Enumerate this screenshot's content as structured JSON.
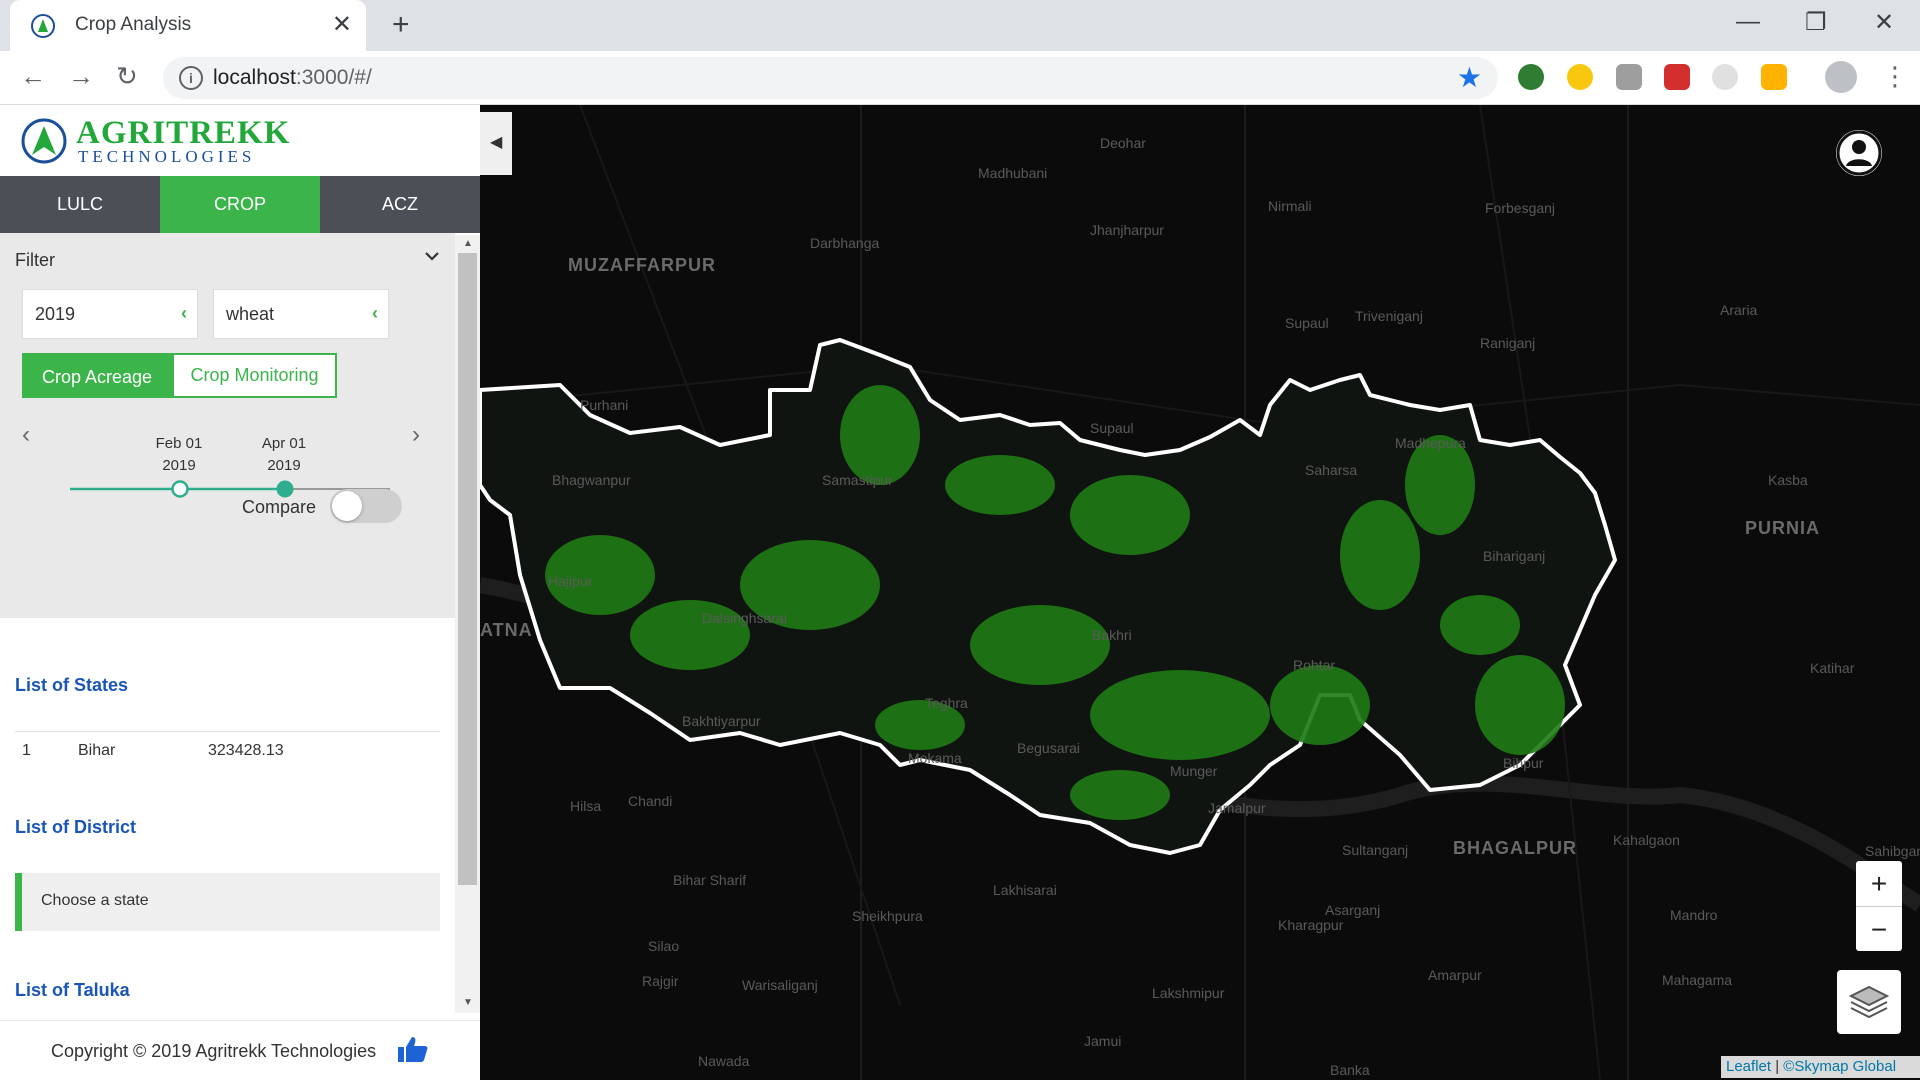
{
  "browser": {
    "tab_title": "Crop Analysis",
    "url_host": "localhost",
    "url_rest": ":3000/#/"
  },
  "app": {
    "brand_line1": "AGRITREKK",
    "brand_line2": "TECHNOLOGIES",
    "tabs": [
      {
        "label": "LULC",
        "active": false
      },
      {
        "label": "CROP",
        "active": true
      },
      {
        "label": "ACZ",
        "active": false
      }
    ],
    "filter": {
      "title": "Filter",
      "year": "2019",
      "crop": "wheat",
      "btn_acreage": "Crop Acreage",
      "btn_monitoring": "Crop Monitoring",
      "timeline": [
        {
          "date": "Feb 01",
          "year": "2019"
        },
        {
          "date": "Apr 01",
          "year": "2019"
        }
      ],
      "compare_label": "Compare",
      "compare_on": false
    },
    "states": {
      "heading": "List of States",
      "rows": [
        {
          "index": "1",
          "name": "Bihar",
          "value": "323428.13"
        }
      ]
    },
    "district": {
      "heading": "List of District",
      "placeholder": "Choose a state"
    },
    "taluka": {
      "heading": "List of Taluka"
    },
    "footer": "Copyright © 2019 Agritrekk Technologies"
  },
  "map": {
    "zoom_in": "+",
    "zoom_out": "−",
    "attribution_leaflet": "Leaflet",
    "attribution_sep": " | ",
    "attribution_tiles": "©Skymap Global",
    "places": [
      "MUZAFFARPUR",
      "Darbhanga",
      "Madhubani",
      "Deohar",
      "Jhanjharpur",
      "Nirmali",
      "Supaul",
      "Forbesganj",
      "Triveniganj",
      "Raniganj",
      "Araria",
      "Purhani",
      "Bhagwanpur",
      "Samastipur",
      "Supaul",
      "Madhepura",
      "Saharsa",
      "Kasba",
      "PURNIA",
      "Hajipur",
      "ATNA",
      "Bihariganj",
      "Katihar",
      "Dalsinghsarai",
      "Bakhri",
      "Rohtar",
      "Bakhtiyarpur",
      "Teghra",
      "Begusarai",
      "Mokama",
      "Munger",
      "Jamalpur",
      "Bihpur",
      "Sultanganj",
      "BHAGALPUR",
      "Kahalgaon",
      "Sahibganj",
      "Hilsa",
      "Chandi",
      "Bihar Sharif",
      "Lakhisarai",
      "Kharagpur",
      "Asarganj",
      "Sheikhpura",
      "Silao",
      "Rajgir",
      "Warisaliganj",
      "Lakshmipur",
      "Amarpur",
      "Mahagama",
      "Mandro",
      "Jamui",
      "Nawada",
      "Banka"
    ]
  }
}
